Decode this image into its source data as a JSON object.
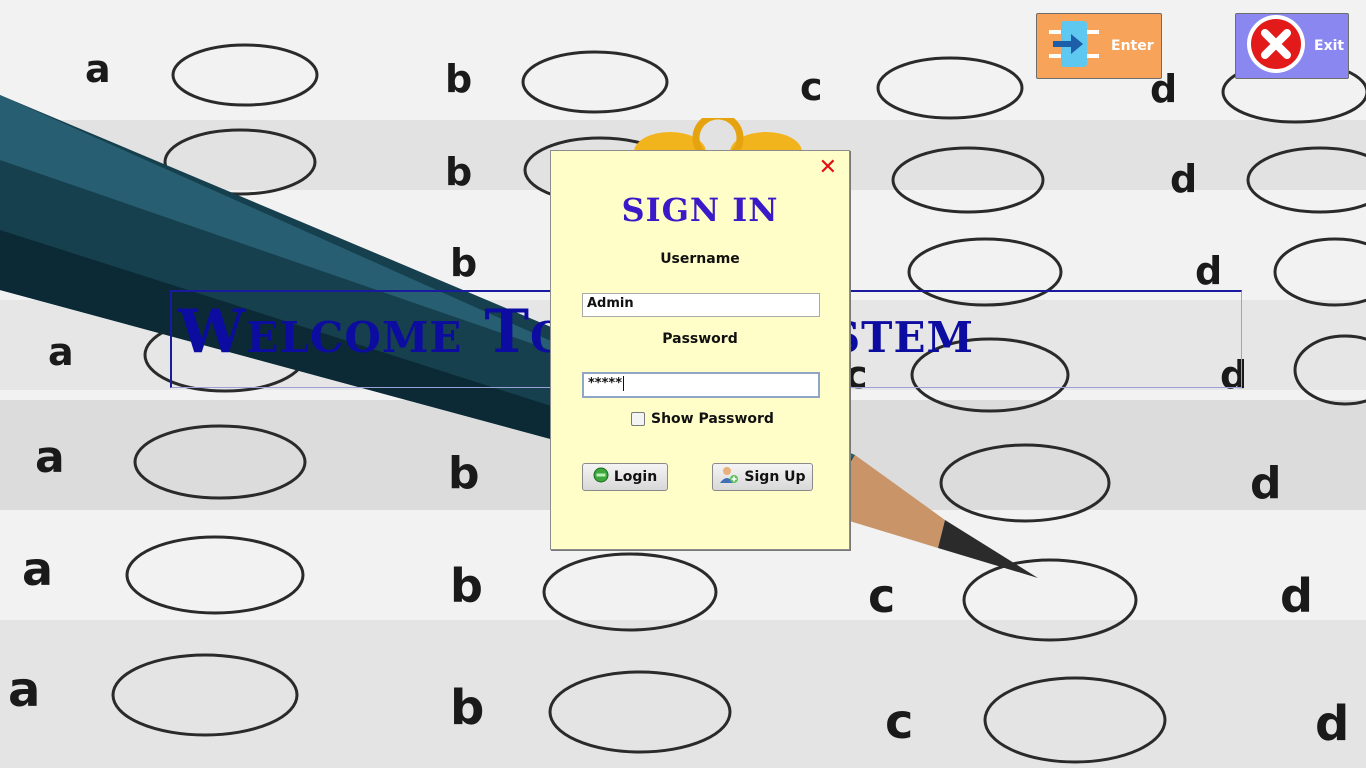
{
  "background": {
    "letters": [
      "a",
      "b",
      "c",
      "d"
    ]
  },
  "banner": {
    "text": "Welcome To Quiz System"
  },
  "top_buttons": {
    "enter_label": "Enter",
    "enter_icon": "enter-arrow-icon",
    "exit_label": "Exit",
    "exit_icon": "close-circle-icon"
  },
  "dialog": {
    "title": "SIGN IN",
    "close_icon": "close-icon",
    "username_label": "Username",
    "username_value": "Admin",
    "password_label": "Password",
    "password_value": "*****",
    "show_password_label": "Show Password",
    "show_password_checked": false,
    "login_label": "Login",
    "signup_label": "Sign Up"
  },
  "colors": {
    "banner_text": "#0c0ca0",
    "dialog_bg": "#fffdc8",
    "title": "#3a1ac8",
    "enter_btn": "#f7a35a",
    "exit_btn": "#8a88f0",
    "close": "#e01010"
  }
}
